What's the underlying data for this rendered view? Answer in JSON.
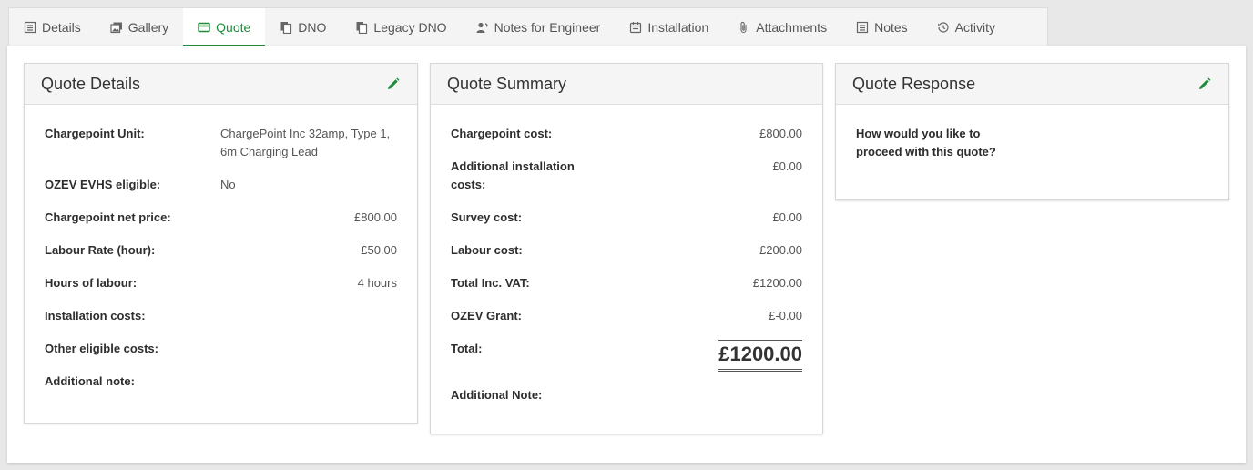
{
  "tabs": [
    {
      "label": "Details",
      "icon": "list-icon"
    },
    {
      "label": "Gallery",
      "icon": "gallery-icon"
    },
    {
      "label": "Quote",
      "icon": "card-icon",
      "active": true
    },
    {
      "label": "DNO",
      "icon": "copy-icon"
    },
    {
      "label": "Legacy DNO",
      "icon": "copy-icon"
    },
    {
      "label": "Notes for Engineer",
      "icon": "engineer-icon"
    },
    {
      "label": "Installation",
      "icon": "calendar-icon"
    },
    {
      "label": "Attachments",
      "icon": "paperclip-icon"
    },
    {
      "label": "Notes",
      "icon": "list-icon"
    },
    {
      "label": "Activity",
      "icon": "history-icon"
    }
  ],
  "accent_color": "#1e8c3a",
  "quote_details": {
    "title": "Quote Details",
    "rows": [
      {
        "label": "Chargepoint Unit:",
        "value": "ChargePoint Inc 32amp, Type 1, 6m Charging Lead"
      },
      {
        "label": "OZEV EVHS eligible:",
        "value": "No"
      },
      {
        "label": "Chargepoint net price:",
        "value": "£800.00"
      },
      {
        "label": "Labour Rate (hour):",
        "value": "£50.00"
      },
      {
        "label": "Hours of labour:",
        "value": "4 hours"
      },
      {
        "label": "Installation costs:",
        "value": ""
      },
      {
        "label": "Other eligible costs:",
        "value": ""
      },
      {
        "label": "Additional note:",
        "value": ""
      }
    ]
  },
  "quote_summary": {
    "title": "Quote Summary",
    "rows": [
      {
        "label": "Chargepoint cost:",
        "value": "£800.00"
      },
      {
        "label": "Additional installation costs:",
        "value": "£0.00"
      },
      {
        "label": "Survey cost:",
        "value": "£0.00"
      },
      {
        "label": "Labour cost:",
        "value": "£200.00"
      },
      {
        "label": "Total Inc. VAT:",
        "value": "£1200.00"
      },
      {
        "label": "OZEV Grant:",
        "value": "£-0.00"
      }
    ],
    "total_label": "Total:",
    "total_value": "£1200.00",
    "additional_note_label": "Additional Note:"
  },
  "quote_response": {
    "title": "Quote Response",
    "question": "How would you like to proceed with this quote?"
  }
}
